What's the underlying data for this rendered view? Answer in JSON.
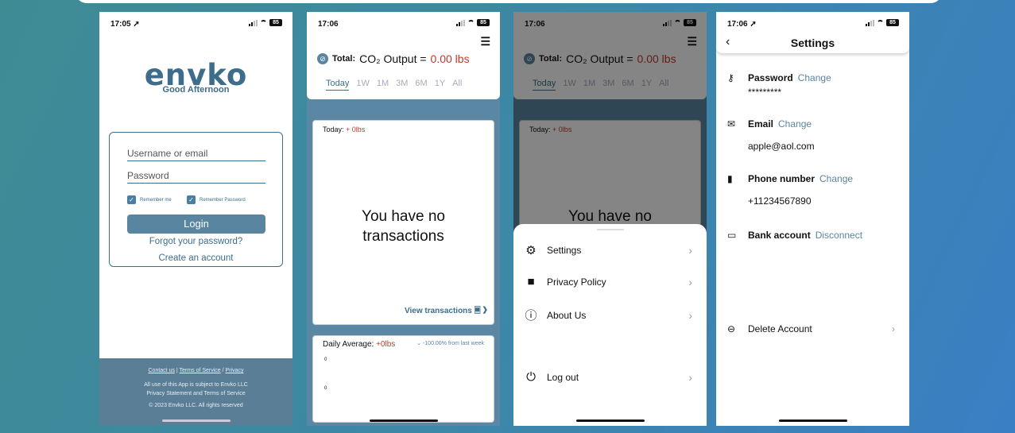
{
  "phone1": {
    "time": "17:05 ➚",
    "logo": "envko",
    "greeting": "Good Afternoon",
    "username_placeholder": "Username or email",
    "password_placeholder": "Password",
    "remember_me": "Remember me",
    "remember_password": "Remember Password",
    "login": "Login",
    "forgot": "Forgot your password?",
    "create": "Create an account",
    "contact": "Contact us",
    "terms": "Terms of Service",
    "privacy": "Privacy",
    "line1": "All use of this App is subject to Envko LLC",
    "line2": "Privacy Statement and Terms of Service",
    "copyright": "© 2023 Envko LLC. All rights reserved"
  },
  "phone2": {
    "time": "17:06",
    "total_label": "Total:",
    "co2": "CO₂ Output =",
    "co2_value": "0.00 lbs",
    "tabs": [
      "Today",
      "1W",
      "1M",
      "3M",
      "6M",
      "1Y",
      "All"
    ],
    "today_label": "Today:",
    "today_value": "+ 0lbs",
    "no_tx_1": "You have no",
    "no_tx_2": "transactions",
    "view_tx": "View transactions",
    "daily_avg": "Daily Average:",
    "daily_val": "+0lbs",
    "pct": "-100.00% from last week",
    "zero": "0"
  },
  "phone3": {
    "time": "17:06",
    "total_label": "Total:",
    "co2": "CO₂ Output =",
    "co2_value": "0.00 lbs",
    "tabs": [
      "Today",
      "1W",
      "1M",
      "3M",
      "6M",
      "1Y",
      "All"
    ],
    "today_label": "Today:",
    "today_value": "+ 0lbs",
    "no_tx": "You have no",
    "menu": {
      "settings": "Settings",
      "privacy": "Privacy Policy",
      "about": "About Us",
      "logout": "Log out"
    }
  },
  "phone4": {
    "time": "17:06 ➚",
    "title": "Settings",
    "password_label": "Password",
    "password_action": "Change",
    "password_value": "*********",
    "email_label": "Email",
    "email_action": "Change",
    "email_value": "apple@aol.com",
    "phone_label": "Phone number",
    "phone_action": "Change",
    "phone_value": "+11234567890",
    "bank_label": "Bank account",
    "bank_action": "Disconnect",
    "delete": "Delete Account"
  },
  "battery": "85"
}
